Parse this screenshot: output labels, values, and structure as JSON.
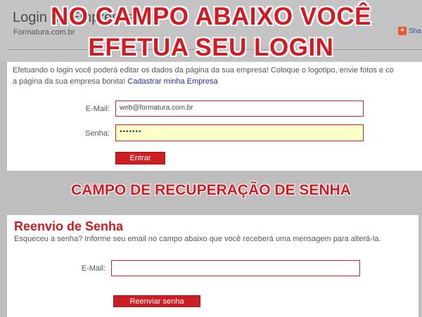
{
  "overlay": {
    "line1": "NO CAMPO ABAIXO VOCÊ",
    "line2": "EFETUA SEU LOGIN",
    "mid_heading": "CAMPO DE RECUPERAÇÃO DE SENHA"
  },
  "header": {
    "title": "Login de Empresas",
    "site_name": "Formatura.com.br",
    "share_label": "Sha"
  },
  "login": {
    "intro_text": "Efetuando o login você poderá editar os dados da página da sua empresa! Coloque o logotipo, envie fotos e co",
    "intro_text2": "a página da sua empresa bonita!",
    "register_link": "Cadastrar minha Empresa",
    "email_label": "E-Mail:",
    "email_value": "web@formatura.com.br",
    "password_label": "Senha:",
    "password_value": "•••••••",
    "submit_label": "Entrar"
  },
  "recovery": {
    "title": "Reenvio de Senha",
    "description": "Esqueceu a senha? Informe seu email no campo abaixo que você receberá uma mensagem para alterá-la.",
    "email_label": "E-Mail:",
    "email_value": "",
    "submit_label": "Reenviar senha"
  },
  "colors": {
    "accent": "#cc1f24",
    "overlay_text": "#d21a22",
    "password_bg": "#ffffc8",
    "link": "#2a2a9c"
  },
  "icons": {
    "share": "share-plus-icon"
  }
}
